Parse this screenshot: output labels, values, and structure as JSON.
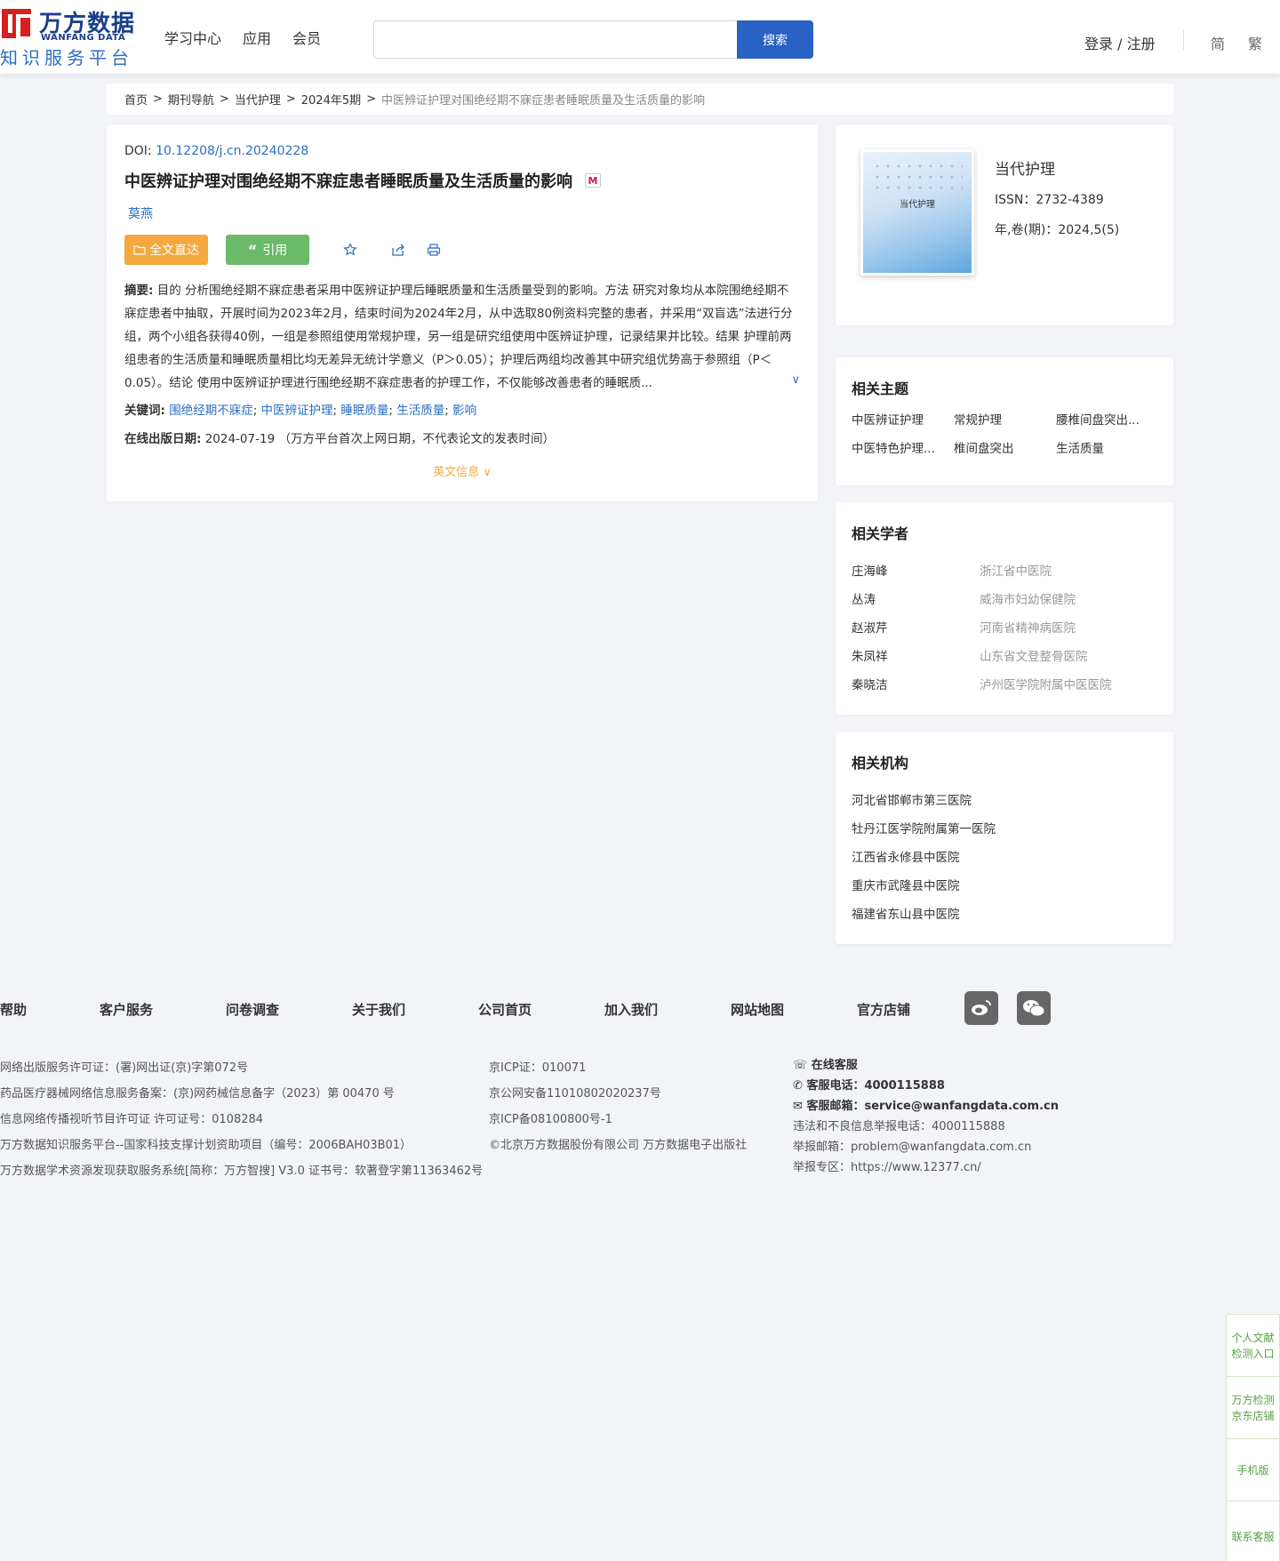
{
  "header": {
    "logo_cn": "万方数据",
    "logo_en": "WANFANG DATA",
    "logo_sub": "知识服务平台",
    "nav": [
      "学习中心",
      "应用",
      "会员"
    ],
    "search_button": "搜索",
    "login": "登录 / 注册",
    "lang_simplified": "简",
    "lang_traditional": "繁"
  },
  "breadcrumb": {
    "items": [
      "首页",
      "期刊导航",
      "当代护理",
      "2024年5期"
    ],
    "current": "中医辨证护理对围绝经期不寐症患者睡眠质量及生活质量的影响"
  },
  "article": {
    "doi_label": "DOI: ",
    "doi": "10.12208/j.cn.20240228",
    "title": "中医辨证护理对围绝经期不寐症患者睡眠质量及生活质量的影响",
    "m_badge": "M",
    "author": "莫燕",
    "btn_fulltext": "全文直达",
    "btn_cite": "引用",
    "abstract_label": "摘要:",
    "abstract": "目的 分析围绝经期不寐症患者采用中医辨证护理后睡眠质量和生活质量受到的影响。方法 研究对象均从本院围绝经期不寐症患者中抽取，开展时间为2023年2月，结束时间为2024年2月，从中选取80例资料完整的患者，并采用“双盲选”法进行分组，两个小组各获得40例，一组是参照组使用常规护理，另一组是研究组使用中医辨证护理，记录结果并比较。结果 护理前两组患者的生活质量和睡眠质量相比均无差异无统计学意义（P＞0.05）；护理后两组均改善其中研究组优势高于参照组（P＜0.05）。结论 使用中医辨证护理进行围绝经期不寐症患者的护理工作，不仅能够改善患者的睡眠质...",
    "keywords_label": "关键词:",
    "keywords": [
      "围绝经期不寐症",
      "中医辨证护理",
      "睡眠质量",
      "生活质量",
      "影响"
    ],
    "pubdate_label": "在线出版日期:",
    "pubdate": "2024-07-19",
    "pubdate_note": "（万方平台首次上网日期，不代表论文的发表时间）",
    "english_info": "英文信息"
  },
  "journal": {
    "cover_title": "当代护理",
    "name": "当代护理",
    "issn": "ISSN：2732-4389",
    "volume": "年,卷(期)：2024,5(5)"
  },
  "topics": {
    "title": "相关主题",
    "items": [
      "中医辨证护理",
      "常规护理",
      "腰椎间盘突出...",
      "中医特色护理...",
      "椎间盘突出",
      "生活质量"
    ]
  },
  "scholars": {
    "title": "相关学者",
    "items": [
      {
        "name": "庄海峰",
        "org": "浙江省中医院"
      },
      {
        "name": "丛涛",
        "org": "威海市妇幼保健院"
      },
      {
        "name": "赵淑芹",
        "org": "河南省精神病医院"
      },
      {
        "name": "朱凤祥",
        "org": "山东省文登整骨医院"
      },
      {
        "name": "秦晓洁",
        "org": "泸州医学院附属中医医院"
      }
    ]
  },
  "institutions": {
    "title": "相关机构",
    "items": [
      "河北省邯郸市第三医院",
      "牡丹江医学院附属第一医院",
      "江西省永修县中医院",
      "重庆市武隆县中医院",
      "福建省东山县中医院"
    ]
  },
  "footer": {
    "nav": [
      "帮助",
      "客户服务",
      "问卷调查",
      "关于我们",
      "公司首页",
      "加入我们",
      "网站地图",
      "官方店铺"
    ],
    "col1": [
      "网络出版服务许可证：(署)网出证(京)字第072号",
      "药品医疗器械网络信息服务备案：(京)网药械信息备字（2023）第 00470 号",
      "信息网络传播视听节目许可证 许可证号：0108284",
      "万方数据知识服务平台--国家科技支撑计划资助项目（编号：2006BAH03B01）",
      "万方数据学术资源发现获取服务系统[简称：万方智搜] V3.0 证书号：软著登字第11363462号"
    ],
    "col2": [
      "京ICP证：010071",
      "京公网安备11010802020237号",
      "京ICP备08100800号-1",
      "©北京万方数据股份有限公司 万方数据电子出版社"
    ],
    "online_service": "在线客服",
    "phone_label": "客服电话：",
    "phone": "4000115888",
    "email_label": "客服邮箱：",
    "email": "service@wanfangdata.com.cn",
    "report_phone": "违法和不良信息举报电话：4000115888",
    "report_email": "举报邮箱：problem@wanfangdata.com.cn",
    "report_site": "举报专区：https://www.12377.cn/"
  },
  "float_panel": [
    "个人文献检测入口",
    "万方检测京东店铺",
    "手机版",
    "联系客服"
  ]
}
